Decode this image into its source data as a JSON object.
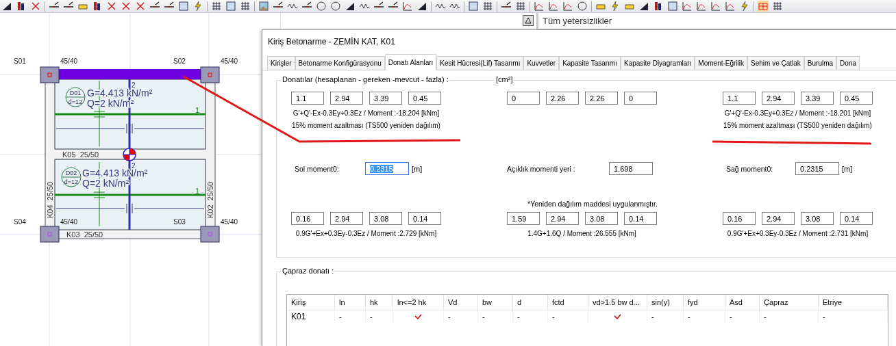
{
  "plan": {
    "columns": [
      {
        "name": "S01",
        "size": "45/40"
      },
      {
        "name": "S02",
        "size": "45/40"
      },
      {
        "name": "S04",
        "size": "45/40"
      },
      {
        "name": "S03",
        "size": "45/40"
      }
    ],
    "beams": [
      {
        "name": "K05",
        "size": "25/50"
      },
      {
        "name": "K03",
        "size": "25/50"
      },
      {
        "name": "K04",
        "size": "25/50"
      },
      {
        "name": "K02",
        "size": "25/50"
      }
    ],
    "slabs": [
      {
        "name": "D01",
        "thickness": "d=12",
        "dead_load": "G=4.413 kN/m²",
        "live_load": "Q=2 kN/m²",
        "axis_1": "1",
        "axis_2": "2"
      },
      {
        "name": "D02",
        "thickness": "d=12",
        "dead_load": "G=4.413 kN/m²",
        "live_load": "Q=2 kN/m²",
        "axis_1": "1",
        "axis_2": "2"
      }
    ]
  },
  "panel": {
    "title": "Tüm yetersizlikler"
  },
  "dialog": {
    "title": "Kiriş Betonarme - ZEMİN KAT, K01",
    "tabs": [
      {
        "label": "Kirişler",
        "selected": false
      },
      {
        "label": "Betonarme Konfigürasyonu",
        "selected": false
      },
      {
        "label": "Donatı Alanları",
        "selected": true
      },
      {
        "label": "Kesit Hücresi(Lif) Tasarımı",
        "selected": false
      },
      {
        "label": "Kuvvetler",
        "selected": false
      },
      {
        "label": "Kapasite Tasarımı",
        "selected": false
      },
      {
        "label": "Kapasite Diyagramları",
        "selected": false
      },
      {
        "label": "Moment-Eğrilik",
        "selected": false
      },
      {
        "label": "Sehim ve Çatlak",
        "selected": false
      },
      {
        "label": "Burulma",
        "selected": false
      },
      {
        "label": "Dona",
        "selected": false
      }
    ],
    "reinforcement": {
      "legend": "Donatılar (hesaplanan - gereken -mevcut - fazla) :",
      "unit": "[cm²]",
      "top": [
        {
          "values": [
            "1.1",
            "2.94",
            "3.39",
            "0.45"
          ],
          "combination": "G'+Q'-Ex-0.3Ey+0.3Ez / Moment :-18.204 [kNm]",
          "note": "15% moment azaltması (TS500 yeniden dağılım)"
        },
        {
          "values": [
            "0",
            "2.26",
            "2.26",
            "0"
          ]
        },
        {
          "values": [
            "1.1",
            "2.94",
            "3.39",
            "0.45"
          ],
          "combination": "G'+Q'-Ex-0.3Ey+0.3Ez / Moment :-18.201 [kNm]",
          "note": "15% moment azaltması (TS500 yeniden dağılım)"
        }
      ],
      "moments": [
        {
          "label": "Sol moment0:",
          "value": "0.2315",
          "unit": "[m]",
          "selected": true
        },
        {
          "label": "Açıklık momenti yeri :",
          "value": "1.698",
          "selected": false
        },
        {
          "label": "Sağ moment0:",
          "value": "0.2315",
          "unit": "[m]",
          "selected": false
        }
      ],
      "redistribution_note": "*Yeniden dağılım maddesi uygulanmıştır.",
      "bottom": [
        {
          "values": [
            "0.16",
            "2.94",
            "3.08",
            "0.14"
          ],
          "combination": "0.9G'+Ex+0.3Ey-0.3Ez / Moment :2.729 [kNm]"
        },
        {
          "values": [
            "1.59",
            "2.94",
            "3.08",
            "0.14"
          ],
          "combination": "1.4G+1.6Q / Moment :26.555 [kNm]"
        },
        {
          "values": [
            "0.16",
            "2.94",
            "3.08",
            "0.14"
          ],
          "combination": "0.9G'+Ex+0.3Ey-0.3Ez / Moment :2.731 [kNm]"
        }
      ]
    },
    "shear": {
      "legend": "Çapraz donatı :",
      "columns": [
        "Kiriş",
        "ln",
        "hk",
        "ln<=2 hk",
        "Vd",
        "bw",
        "d",
        "fctd",
        "vd>1.5 bw d...",
        "sin(y)",
        "fyd",
        "Asd",
        "Çapraz",
        "Etriye"
      ],
      "rows": [
        {
          "cells": [
            {
              "kind": "text",
              "text": "K01"
            },
            {
              "kind": "text",
              "text": "-"
            },
            {
              "kind": "text",
              "text": "-"
            },
            {
              "kind": "check",
              "checked": true
            },
            {
              "kind": "text",
              "text": "-"
            },
            {
              "kind": "text",
              "text": "-"
            },
            {
              "kind": "text",
              "text": "-"
            },
            {
              "kind": "text",
              "text": "-"
            },
            {
              "kind": "check",
              "checked": true
            },
            {
              "kind": "text",
              "text": "-"
            },
            {
              "kind": "text",
              "text": "-"
            },
            {
              "kind": "text",
              "text": "-"
            },
            {
              "kind": "text",
              "text": "-"
            },
            {
              "kind": "text",
              "text": "-"
            }
          ]
        }
      ]
    }
  }
}
